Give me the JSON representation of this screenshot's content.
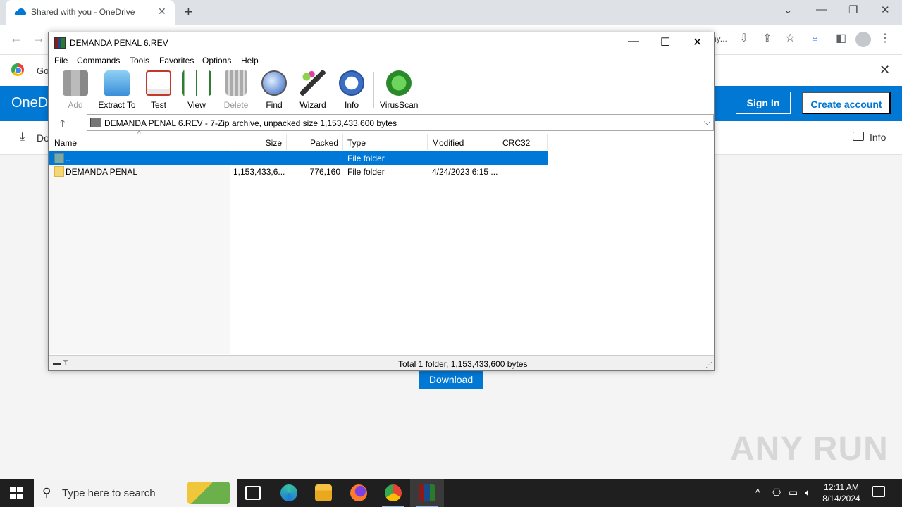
{
  "browser": {
    "tab_title": "Shared with you - OneDrive",
    "tab_close": "✕",
    "new_tab": "+",
    "window_controls": [
      "⌄",
      "—",
      "❐",
      "✕"
    ],
    "omnibox_tail": "ny...",
    "infobar_text": "Go",
    "infobar_close": "✕"
  },
  "onedrive": {
    "brand": "OneD",
    "sign_in": "Sign In",
    "create_account": "Create account",
    "cmd_download": "Do",
    "cmd_info": "Info",
    "download_button": "Download",
    "brand_color": "#0078d4"
  },
  "winrar": {
    "title": "DEMANDA PENAL 6.REV",
    "menu": [
      "File",
      "Commands",
      "Tools",
      "Favorites",
      "Options",
      "Help"
    ],
    "toolbar": [
      {
        "label": "Add",
        "icon": "add-icon",
        "disabled": true
      },
      {
        "label": "Extract To",
        "icon": "extract-icon",
        "disabled": false
      },
      {
        "label": "Test",
        "icon": "test-icon",
        "disabled": false
      },
      {
        "label": "View",
        "icon": "view-icon",
        "disabled": false
      },
      {
        "label": "Delete",
        "icon": "delete-icon",
        "disabled": true
      },
      {
        "label": "Find",
        "icon": "find-icon",
        "disabled": false
      },
      {
        "label": "Wizard",
        "icon": "wizard-icon",
        "disabled": false
      },
      {
        "label": "Info",
        "icon": "info-icon",
        "disabled": false
      },
      {
        "label": "VirusScan",
        "icon": "virusscan-icon",
        "disabled": false
      }
    ],
    "address": "DEMANDA PENAL 6.REV - 7-Zip archive, unpacked size 1,153,433,600 bytes",
    "columns": [
      "Name",
      "Size",
      "Packed",
      "Type",
      "Modified",
      "CRC32"
    ],
    "rows": [
      {
        "name": "..",
        "size": "",
        "packed": "",
        "type": "File folder",
        "modified": "",
        "crc": "",
        "selected": true
      },
      {
        "name": "DEMANDA PENAL",
        "size": "1,153,433,6...",
        "packed": "776,160",
        "type": "File folder",
        "modified": "4/24/2023 6:15 ...",
        "crc": "",
        "selected": false
      }
    ],
    "status": "Total 1 folder, 1,153,433,600 bytes"
  },
  "taskbar": {
    "search_placeholder": "Type here to search",
    "time": "12:11 AM",
    "date": "8/14/2024"
  },
  "watermark": "ANY RUN"
}
